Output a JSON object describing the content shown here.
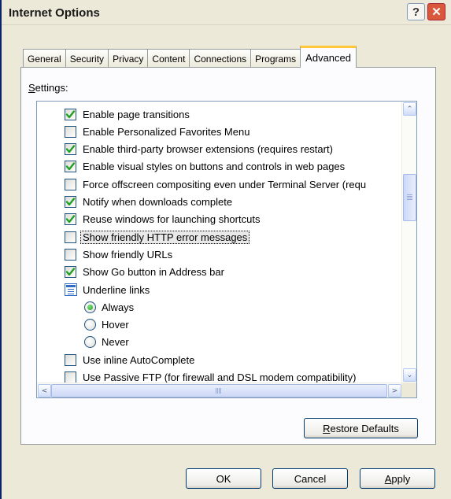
{
  "window": {
    "title": "Internet Options",
    "help_glyph": "?",
    "close_glyph": "✕"
  },
  "tabs": [
    {
      "label": "General",
      "active": false
    },
    {
      "label": "Security",
      "active": false
    },
    {
      "label": "Privacy",
      "active": false
    },
    {
      "label": "Content",
      "active": false
    },
    {
      "label": "Connections",
      "active": false
    },
    {
      "label": "Programs",
      "active": false
    },
    {
      "label": "Advanced",
      "active": true
    }
  ],
  "settings": {
    "label_mnemonic": "S",
    "label_rest": "ettings:",
    "items": [
      {
        "type": "checkbox",
        "checked": true,
        "label": "Enable page transitions"
      },
      {
        "type": "checkbox",
        "checked": false,
        "label": "Enable Personalized Favorites Menu"
      },
      {
        "type": "checkbox",
        "checked": true,
        "label": "Enable third-party browser extensions (requires restart)"
      },
      {
        "type": "checkbox",
        "checked": true,
        "label": "Enable visual styles on buttons and controls in web pages"
      },
      {
        "type": "checkbox",
        "checked": false,
        "label": "Force offscreen compositing even under Terminal Server (requ"
      },
      {
        "type": "checkbox",
        "checked": true,
        "label": "Notify when downloads complete"
      },
      {
        "type": "checkbox",
        "checked": true,
        "label": "Reuse windows for launching shortcuts"
      },
      {
        "type": "checkbox",
        "checked": false,
        "label": "Show friendly HTTP error messages",
        "focused": true
      },
      {
        "type": "checkbox",
        "checked": false,
        "label": "Show friendly URLs"
      },
      {
        "type": "checkbox",
        "checked": true,
        "label": "Show Go button in Address bar"
      },
      {
        "type": "group",
        "label": "Underline links"
      },
      {
        "type": "radio",
        "checked": true,
        "label": "Always"
      },
      {
        "type": "radio",
        "checked": false,
        "label": "Hover"
      },
      {
        "type": "radio",
        "checked": false,
        "label": "Never"
      },
      {
        "type": "checkbox",
        "checked": false,
        "label": "Use inline AutoComplete"
      },
      {
        "type": "checkbox",
        "checked": false,
        "label": "Use Passive FTP (for firewall and DSL modem compatibility)"
      }
    ]
  },
  "scrollbar": {
    "up_glyph": "⌃",
    "down_glyph": "⌄",
    "left_glyph": "<",
    "right_glyph": ">"
  },
  "buttons": {
    "restore_mnemonic": "R",
    "restore_rest": "estore Defaults",
    "ok": "OK",
    "cancel": "Cancel",
    "apply_mnemonic": "A",
    "apply_rest": "pply"
  },
  "colors": {
    "accent_tab": "#ffc83c",
    "checkmark": "#21a121",
    "close_button": "#d9573a"
  },
  "icons": {
    "help": "help-icon",
    "close": "close-icon",
    "check": "checkmark-icon",
    "radio": "radio-dot-icon",
    "group": "settings-group-icon"
  }
}
